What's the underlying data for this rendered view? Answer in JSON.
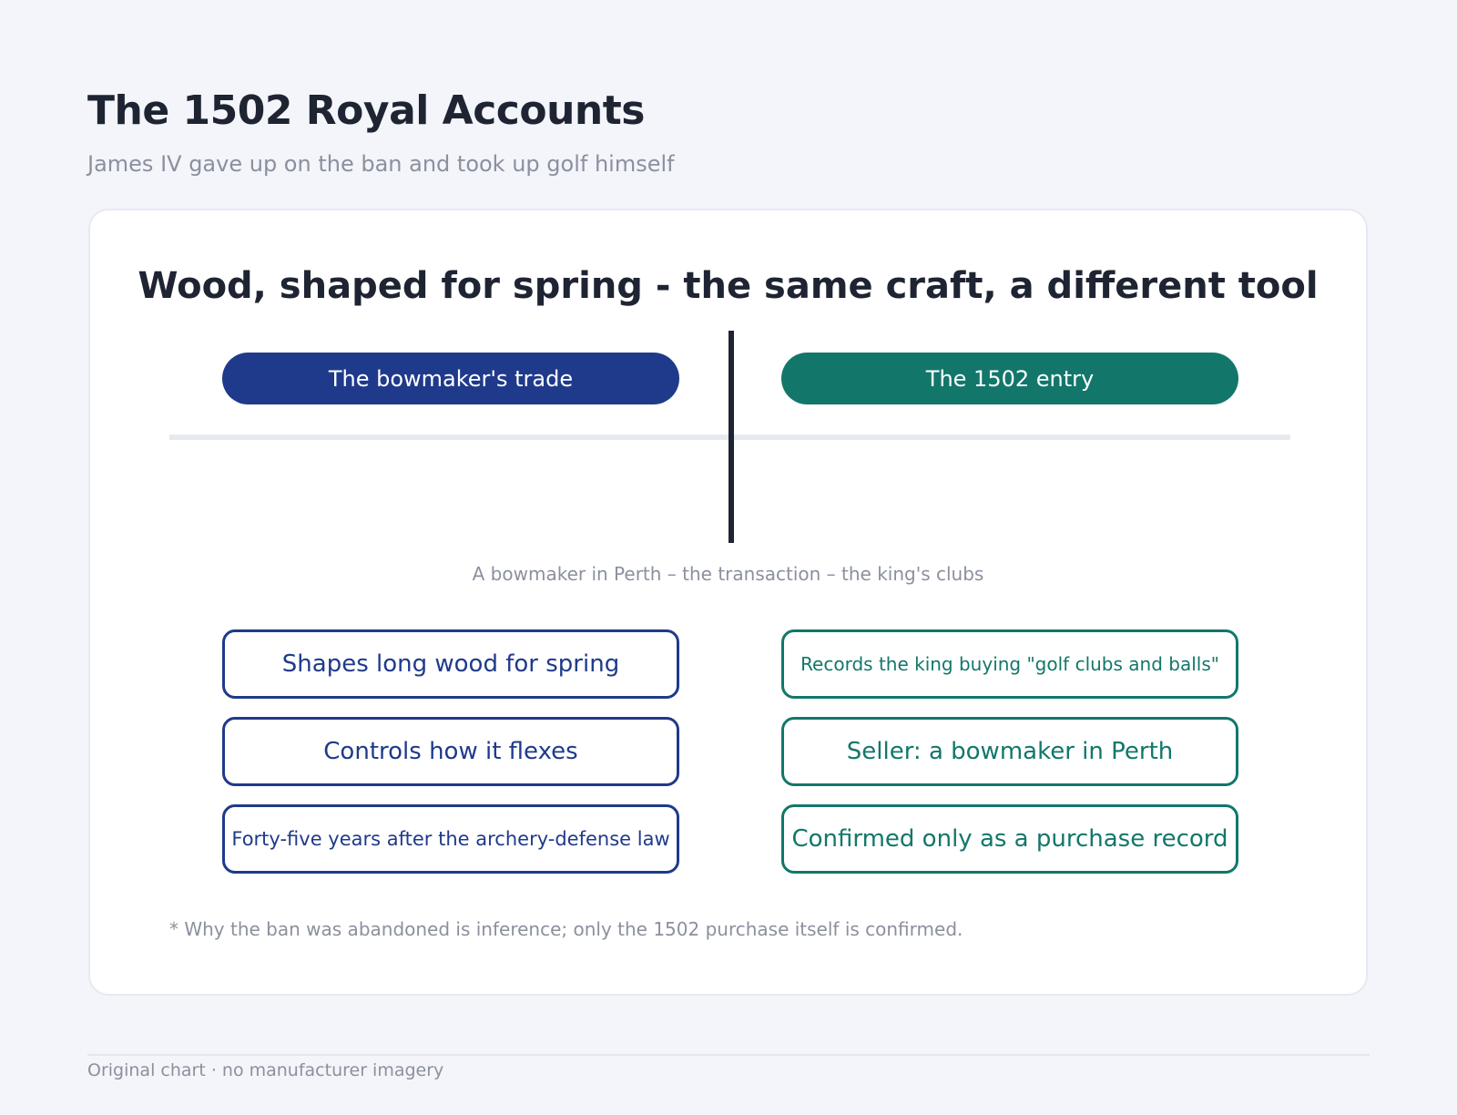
{
  "header": {
    "title": "The 1502 Royal Accounts",
    "subtitle": "James IV gave up on the ban and took up golf himself"
  },
  "diagram": {
    "title": "Wood, shaped for spring - the same craft, a different tool",
    "left": {
      "label": "The bowmaker's trade",
      "color": "#1f3a8b",
      "items": [
        "Shapes long wood for spring",
        "Controls how it flexes",
        "Forty-five years after the archery-defense law"
      ]
    },
    "right": {
      "label": "The 1502 entry",
      "color": "#12776a",
      "items": [
        "Records the king buying \"golf clubs and balls\"",
        "Seller: a bowmaker in Perth",
        "Confirmed only as a purchase record"
      ]
    },
    "caption": "A bowmaker in Perth – the transaction – the king's clubs",
    "footnote": "* Why the ban was abandoned is inference; only the 1502 purchase itself is confirmed."
  },
  "footer": {
    "text": "Original chart · no manufacturer imagery"
  }
}
